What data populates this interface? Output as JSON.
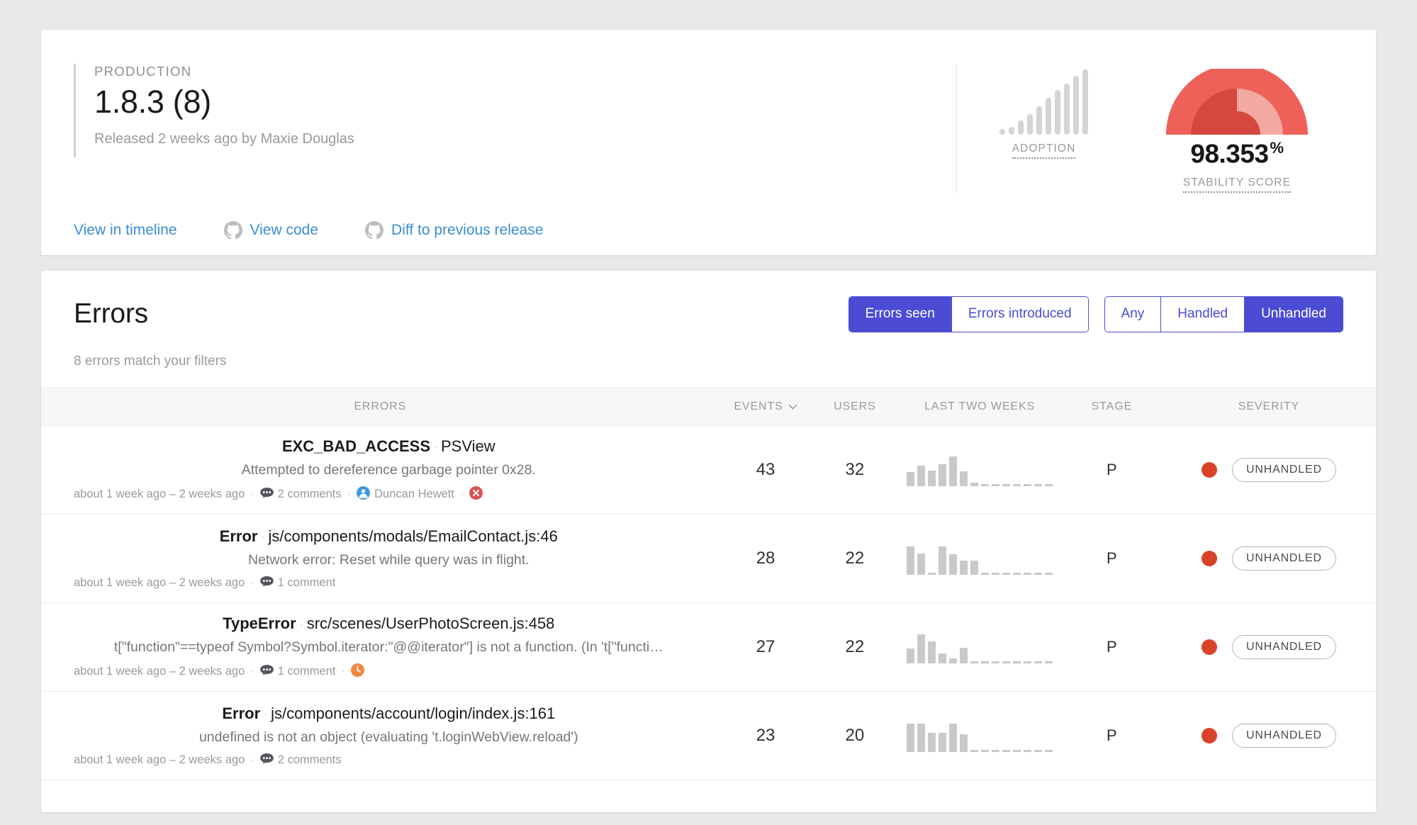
{
  "release": {
    "environment": "PRODUCTION",
    "version": "1.8.3 (8)",
    "released_by": "Released 2 weeks ago by Maxie Douglas",
    "links": [
      {
        "label": "View in timeline",
        "icon": null
      },
      {
        "label": "View code",
        "icon": "github-icon"
      },
      {
        "label": "Diff to previous release",
        "icon": "github-icon"
      }
    ],
    "adoption": {
      "label": "ADOPTION"
    },
    "stability": {
      "label": "STABILITY SCORE",
      "value": "98.353",
      "unit": "%"
    }
  },
  "errors_panel": {
    "title": "Errors",
    "match_count": "8 errors match your filters",
    "filter_group_1": {
      "options": [
        "Errors seen",
        "Errors introduced"
      ],
      "active": "Errors seen"
    },
    "filter_group_2": {
      "options": [
        "Any",
        "Handled",
        "Unhandled"
      ],
      "active": "Unhandled"
    },
    "columns": [
      "ERRORS",
      "EVENTS",
      "USERS",
      "LAST TWO WEEKS",
      "STAGE",
      "SEVERITY"
    ],
    "rows": [
      {
        "class": "EXC_BAD_ACCESS",
        "location": "PSView",
        "message": "Attempted to dereference garbage pointer 0x28.",
        "time": "about 1 week ago – 2 weeks ago",
        "comments": "2 comments",
        "assignee": "Duncan Hewett",
        "flags": [
          "error-x-icon"
        ],
        "events": "43",
        "users": "32",
        "stage": "P",
        "severity": "UNHANDLED"
      },
      {
        "class": "Error",
        "location": "js/components/modals/EmailContact.js:46",
        "message": "Network error: Reset while query was in flight.",
        "time": "about 1 week ago – 2 weeks ago",
        "comments": "1 comment",
        "assignee": null,
        "flags": [],
        "events": "28",
        "users": "22",
        "stage": "P",
        "severity": "UNHANDLED"
      },
      {
        "class": "TypeError",
        "location": "src/scenes/UserPhotoScreen.js:458",
        "message": "t[\"function\"==typeof Symbol?Symbol.iterator:\"@@iterator\"] is not a function. (In 't[\"functi…",
        "time": "about 1 week ago – 2 weeks ago",
        "comments": "1 comment",
        "assignee": null,
        "flags": [
          "snoozed-clock-icon"
        ],
        "events": "27",
        "users": "22",
        "stage": "P",
        "severity": "UNHANDLED"
      },
      {
        "class": "Error",
        "location": "js/components/account/login/index.js:161",
        "message": "undefined is not an object (evaluating 't.loginWebView.reload')",
        "time": "about 1 week ago – 2 weeks ago",
        "comments": "2 comments",
        "assignee": null,
        "flags": [],
        "events": "23",
        "users": "20",
        "stage": "P",
        "severity": "UNHANDLED"
      }
    ]
  },
  "chart_data": [
    {
      "type": "bar",
      "title": "ADOPTION",
      "name": "adoption-sparkline",
      "categories": [
        "1",
        "2",
        "3",
        "4",
        "5",
        "6",
        "7",
        "8",
        "9",
        "10"
      ],
      "values": [
        4,
        12,
        22,
        32,
        44,
        56,
        68,
        78,
        90,
        100
      ],
      "ylim": [
        0,
        100
      ],
      "grid": false,
      "color": "#d4d4d6"
    },
    {
      "type": "gauge",
      "title": "STABILITY SCORE",
      "name": "stability-gauge",
      "value": 98.353,
      "unit": "%",
      "ylim": [
        0,
        100
      ],
      "color": "#ed5f57"
    },
    {
      "type": "bar",
      "title": "LAST TWO WEEKS",
      "name": "row-1-sparkline",
      "categories": [
        "1",
        "2",
        "3",
        "4",
        "5",
        "6",
        "7",
        "8",
        "9",
        "10",
        "11",
        "12",
        "13",
        "14"
      ],
      "values": [
        42,
        62,
        46,
        65,
        88,
        44,
        11,
        2,
        2,
        2,
        2,
        2,
        2,
        2
      ],
      "ylim": [
        0,
        100
      ],
      "grid": false,
      "color": "#c9c9cb"
    },
    {
      "type": "bar",
      "title": "LAST TWO WEEKS",
      "name": "row-2-sparkline",
      "categories": [
        "1",
        "2",
        "3",
        "4",
        "5",
        "6",
        "7",
        "8",
        "9",
        "10",
        "11",
        "12",
        "13",
        "14"
      ],
      "values": [
        85,
        64,
        4,
        85,
        62,
        42,
        42,
        2,
        2,
        2,
        2,
        2,
        2,
        2
      ],
      "ylim": [
        0,
        100
      ],
      "grid": false,
      "color": "#c9c9cb"
    },
    {
      "type": "bar",
      "title": "LAST TWO WEEKS",
      "name": "row-3-sparkline",
      "categories": [
        "1",
        "2",
        "3",
        "4",
        "5",
        "6",
        "7",
        "8",
        "9",
        "10",
        "11",
        "12",
        "13",
        "14"
      ],
      "values": [
        45,
        86,
        66,
        30,
        15,
        46,
        2,
        2,
        2,
        2,
        2,
        2,
        2,
        2
      ],
      "ylim": [
        0,
        100
      ],
      "grid": false,
      "color": "#c9c9cb"
    },
    {
      "type": "bar",
      "title": "LAST TWO WEEKS",
      "name": "row-4-sparkline",
      "categories": [
        "1",
        "2",
        "3",
        "4",
        "5",
        "6",
        "7",
        "8",
        "9",
        "10",
        "11",
        "12",
        "13",
        "14"
      ],
      "values": [
        85,
        85,
        56,
        56,
        85,
        52,
        2,
        2,
        2,
        2,
        2,
        2,
        2,
        2
      ],
      "ylim": [
        0,
        100
      ],
      "grid": false,
      "color": "#c9c9cb"
    }
  ]
}
